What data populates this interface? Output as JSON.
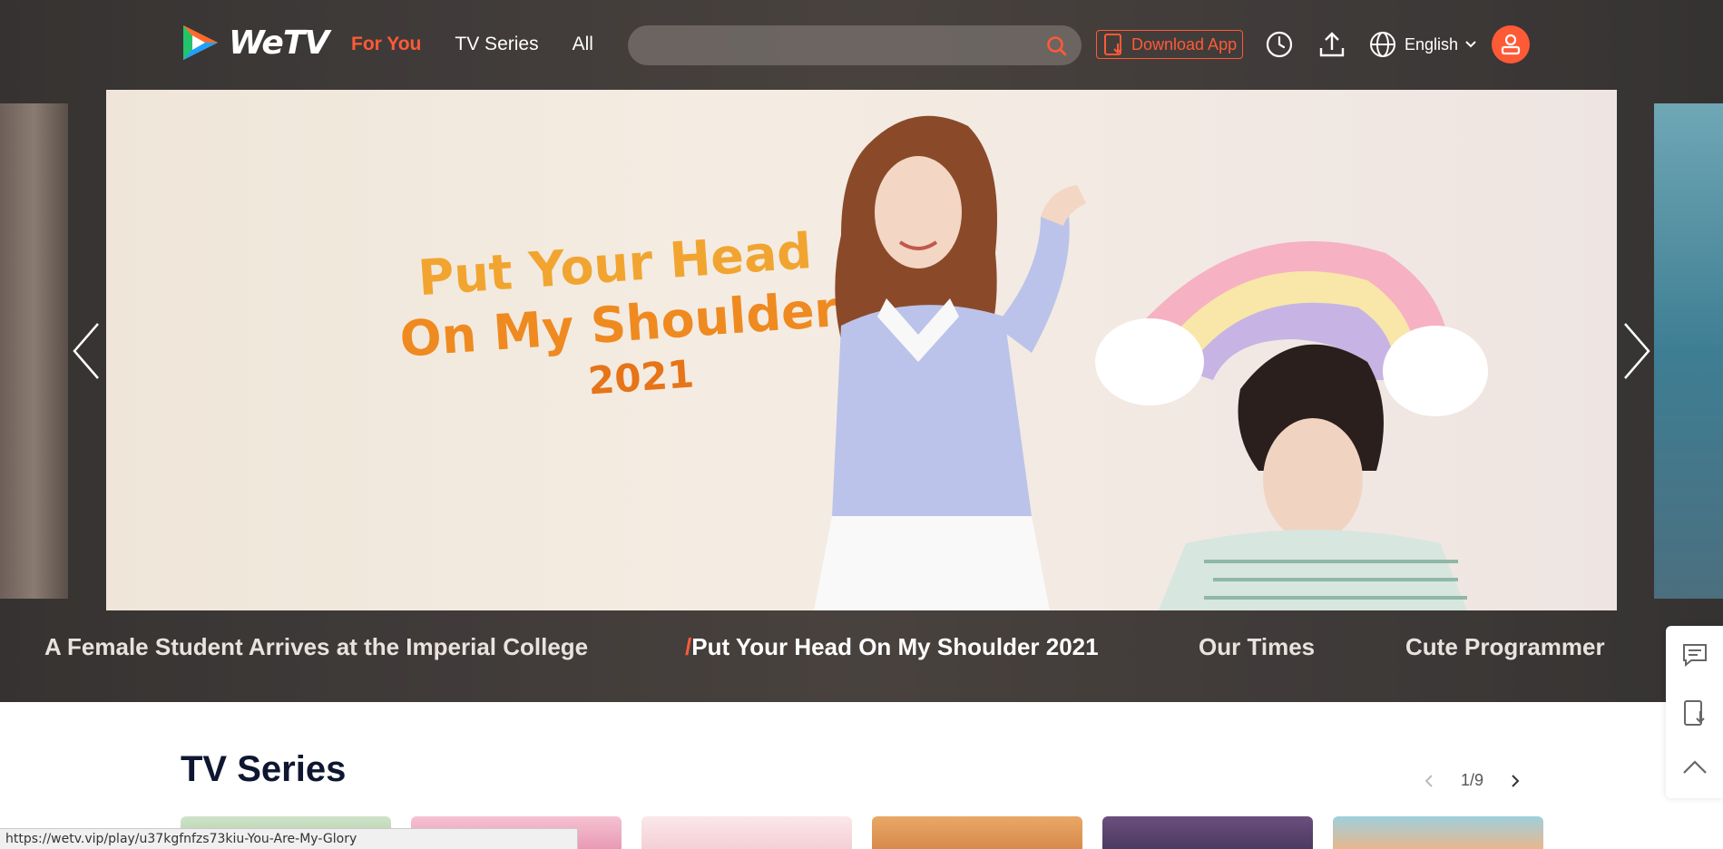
{
  "header": {
    "logo_text": "WeTV",
    "nav": [
      {
        "label": "For You",
        "active": true
      },
      {
        "label": "TV Series",
        "active": false
      },
      {
        "label": "All",
        "active": false
      }
    ],
    "search": {
      "placeholder": "",
      "value": ""
    },
    "download_label": "Download App",
    "language": "English",
    "icons": [
      "history-icon",
      "upload-icon",
      "globe-icon",
      "user-icon"
    ]
  },
  "banner": {
    "title_line1": "Put Your Head",
    "title_line2": "On My Shoulder",
    "title_line3": "2021",
    "captions": [
      {
        "label": "A Female Student Arrives at the Imperial College",
        "active": false
      },
      {
        "label": "Put Your Head On My Shoulder 2021",
        "active": true
      },
      {
        "label": "Our Times",
        "active": false
      },
      {
        "label": "Cute Programmer",
        "active": false
      }
    ],
    "active_marker": "/"
  },
  "section": {
    "title": "TV Series",
    "pager": "1/9"
  },
  "status_url": "https://wetv.vip/play/u37kgfnfzs73kiu-You-Are-My-Glory",
  "colors": {
    "accent": "#ff5a36",
    "header_bg": "#3d3a38",
    "section_title": "#0f1631"
  }
}
